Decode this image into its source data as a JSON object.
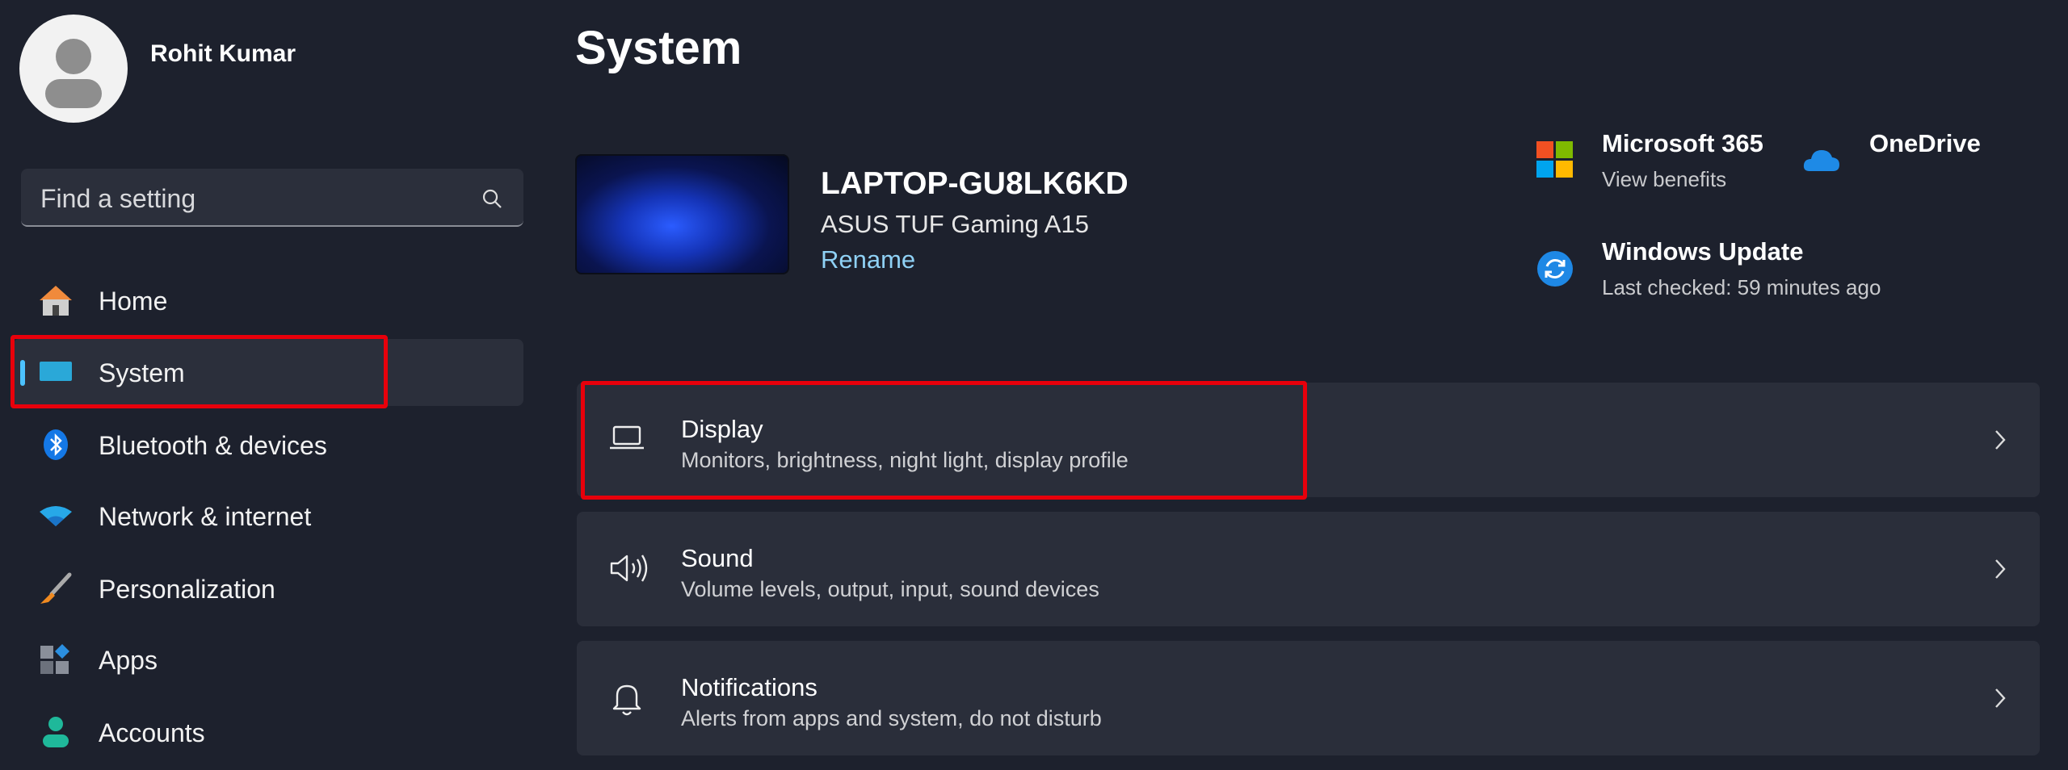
{
  "user": {
    "name": "Rohit Kumar"
  },
  "search": {
    "placeholder": "Find a setting"
  },
  "sidebar": {
    "items": [
      {
        "label": "Home",
        "icon": "home-icon"
      },
      {
        "label": "System",
        "icon": "system-icon",
        "selected": true
      },
      {
        "label": "Bluetooth & devices",
        "icon": "bluetooth-icon"
      },
      {
        "label": "Network & internet",
        "icon": "wifi-icon"
      },
      {
        "label": "Personalization",
        "icon": "brush-icon"
      },
      {
        "label": "Apps",
        "icon": "apps-icon"
      },
      {
        "label": "Accounts",
        "icon": "account-icon"
      }
    ]
  },
  "main": {
    "title": "System",
    "device": {
      "name": "LAPTOP-GU8LK6KD",
      "model": "ASUS TUF Gaming A15",
      "rename": "Rename"
    },
    "quick": {
      "m365": {
        "title": "Microsoft 365",
        "subtitle": "View benefits"
      },
      "onedrive": {
        "title": "OneDrive"
      },
      "update": {
        "title": "Windows Update",
        "subtitle": "Last checked: 59 minutes ago"
      }
    },
    "cards": [
      {
        "title": "Display",
        "subtitle": "Monitors, brightness, night light, display profile",
        "icon": "laptop-icon"
      },
      {
        "title": "Sound",
        "subtitle": "Volume levels, output, input, sound devices",
        "icon": "speaker-icon"
      },
      {
        "title": "Notifications",
        "subtitle": "Alerts from apps and system, do not disturb",
        "icon": "bell-icon"
      }
    ]
  },
  "colors": {
    "accent": "#4cc2ff",
    "highlight": "#e8000b",
    "link": "#8fd1f5"
  }
}
